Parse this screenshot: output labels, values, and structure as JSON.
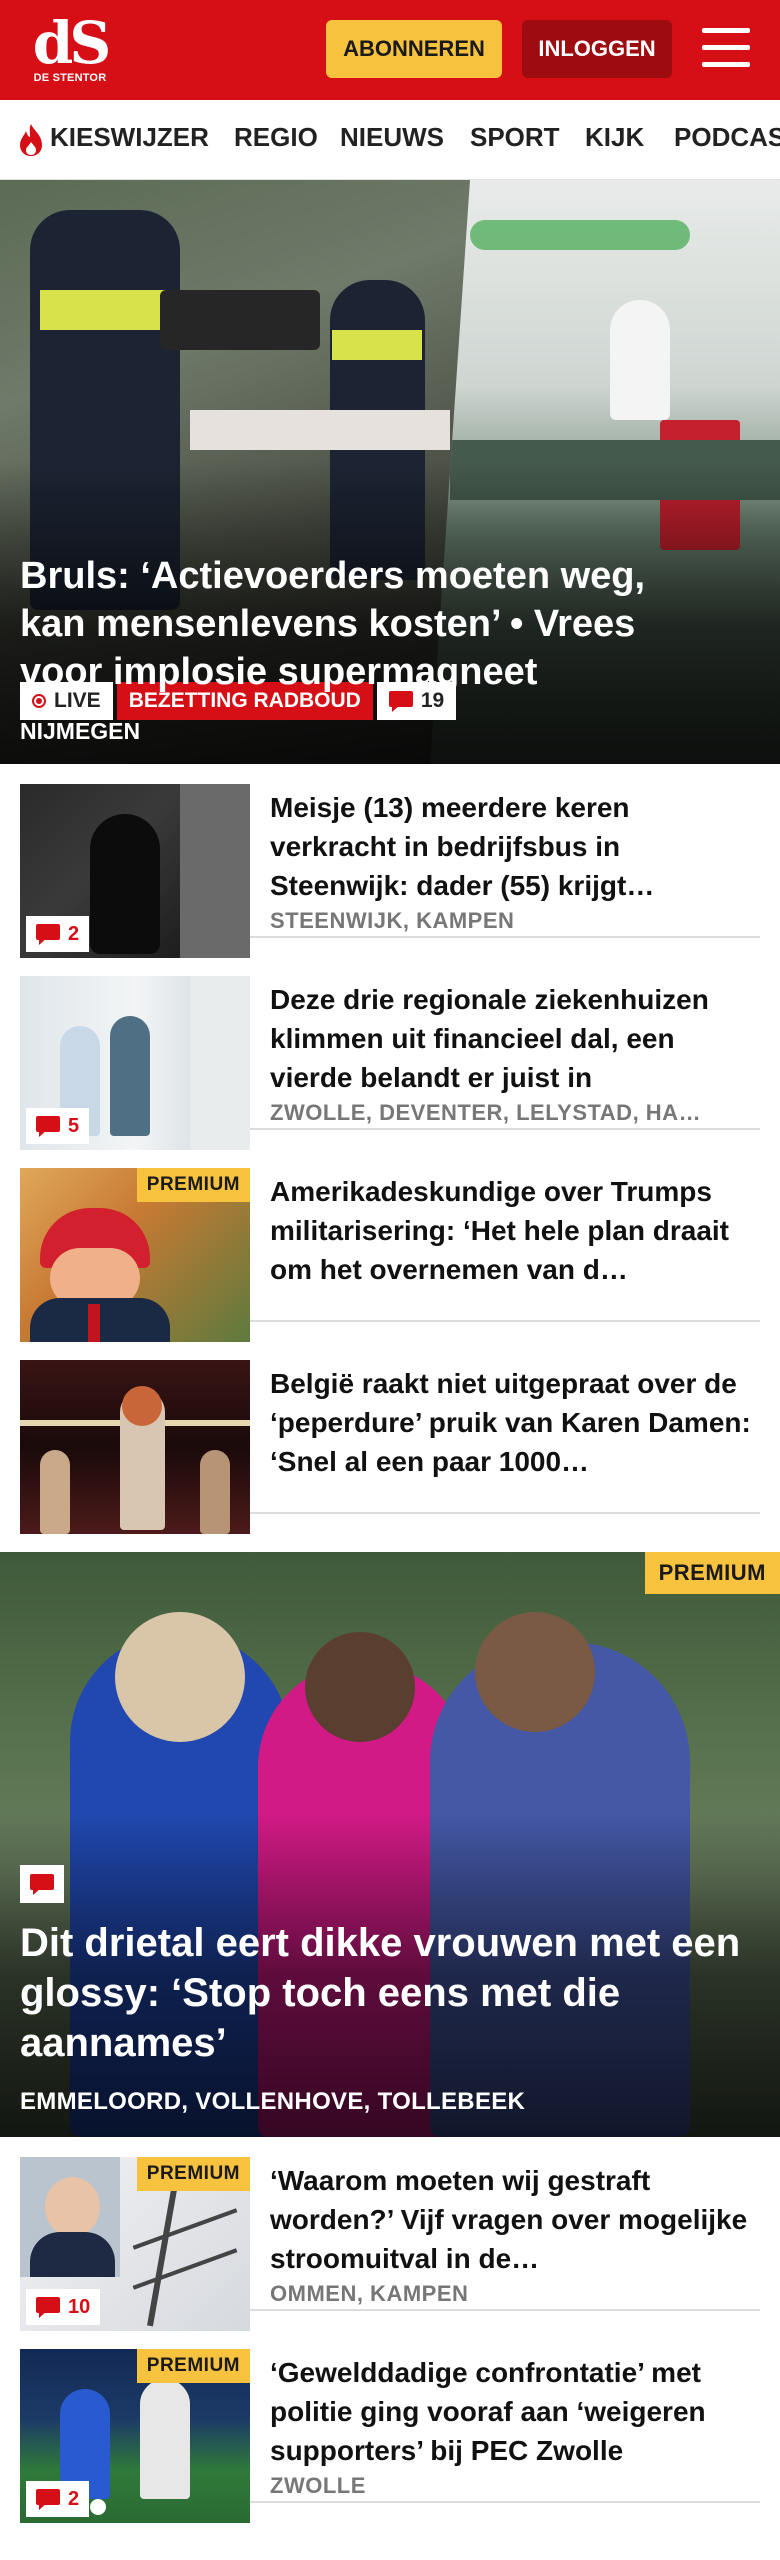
{
  "header": {
    "logo_mark": "dS",
    "logo_text": "DE STENTOR",
    "subscribe_label": "ABONNEREN",
    "login_label": "INLOGGEN",
    "menu_icon": "hamburger-menu-icon"
  },
  "nav": {
    "items": [
      "KIESWIJZER",
      "REGIO",
      "NIEUWS",
      "SPORT",
      "KIJK",
      "PODCAS"
    ],
    "highlight_icon": "flame-icon"
  },
  "hero": {
    "live_label": "LIVE",
    "topic": "BEZETTING RADBOUD",
    "comment_count": "19",
    "title": "Bruls: ‘Actievoerders moeten weg, kan mensenlevens kosten’ • Vrees voor implosie supermagneet",
    "location": "NIJMEGEN"
  },
  "articles": [
    {
      "title": "Meisje (13) meerdere keren verkracht in bedrijfsbus in Steenwijk: dader (55) krijgt…",
      "location": "STEENWIJK, KAMPEN",
      "comments": "2",
      "premium": ""
    },
    {
      "title": "Deze drie regionale ziekenhuizen klimmen uit financieel dal, een vierde belandt er juist in",
      "location": "ZWOLLE, DEVENTER, LELYSTAD, HA…",
      "comments": "5",
      "premium": ""
    },
    {
      "title": "Amerikadeskundige over Trumps militarisering: ‘Het hele plan draait om het overnemen van d…",
      "location": "",
      "comments": "",
      "premium": "PREMIUM"
    },
    {
      "title": "België raakt niet uitgepraat over de ‘peperdure’ pruik van Karen Damen: ‘Snel al een paar 1000…",
      "location": "",
      "comments": "",
      "premium": ""
    }
  ],
  "feature": {
    "premium": "PREMIUM",
    "title": "Dit drietal eert dikke vrouwen met een glossy: ‘Stop toch eens met die aannames’",
    "location": "EMMELOORD, VOLLENHOVE, TOLLEBEEK"
  },
  "articles2": [
    {
      "title": "‘Waarom moeten wij gestraft worden?’ Vijf vragen over mogelijke stroomuitval in de…",
      "location": "OMMEN, KAMPEN",
      "comments": "10",
      "premium": "PREMIUM"
    },
    {
      "title": "‘Gewelddadige confrontatie’ met politie ging vooraf aan ‘weigeren supporters’ bij PEC Zwolle",
      "location": "ZWOLLE",
      "comments": "2",
      "premium": "PREMIUM"
    }
  ],
  "colors": {
    "brand_red": "#d50f15",
    "premium_yellow": "#f7c23d",
    "login_dark_red": "#9e0c10"
  }
}
